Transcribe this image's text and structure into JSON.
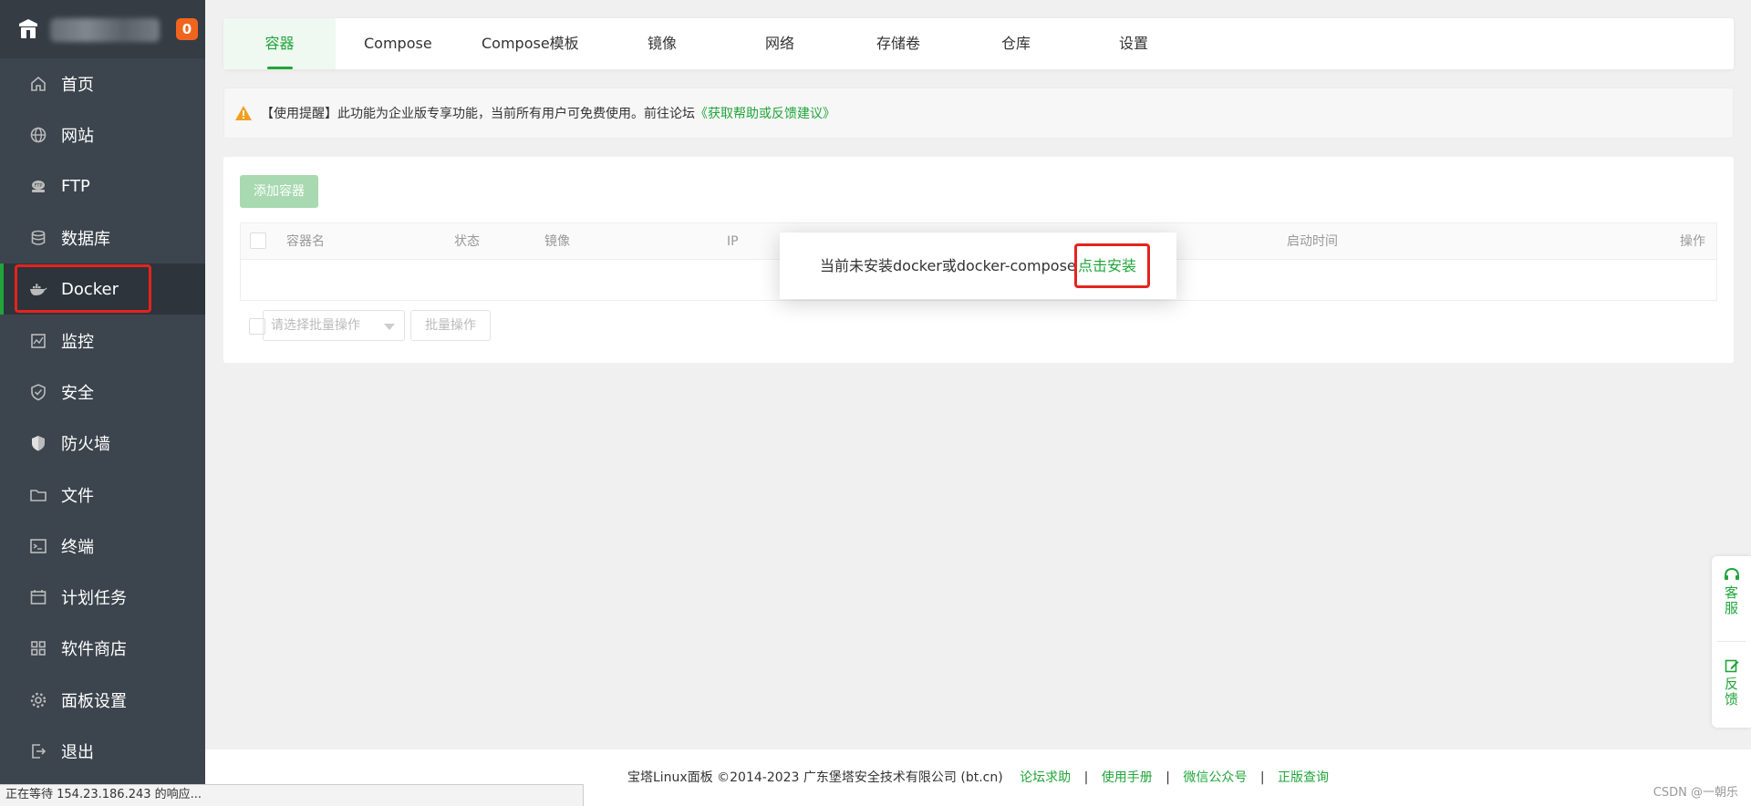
{
  "sidebar": {
    "badge": "0",
    "items": [
      {
        "label": "首页",
        "icon": "home-icon"
      },
      {
        "label": "网站",
        "icon": "globe-icon"
      },
      {
        "label": "FTP",
        "icon": "ftp-icon"
      },
      {
        "label": "数据库",
        "icon": "database-icon"
      },
      {
        "label": "Docker",
        "icon": "docker-icon",
        "active": true
      },
      {
        "label": "监控",
        "icon": "monitor-icon"
      },
      {
        "label": "安全",
        "icon": "shield-icon"
      },
      {
        "label": "防火墙",
        "icon": "firewall-icon"
      },
      {
        "label": "文件",
        "icon": "folder-icon"
      },
      {
        "label": "终端",
        "icon": "terminal-icon"
      },
      {
        "label": "计划任务",
        "icon": "calendar-icon"
      },
      {
        "label": "软件商店",
        "icon": "grid-icon"
      },
      {
        "label": "面板设置",
        "icon": "gear-icon"
      },
      {
        "label": "退出",
        "icon": "logout-icon"
      }
    ]
  },
  "tabs": [
    "容器",
    "Compose",
    "Compose模板",
    "镜像",
    "网络",
    "存储卷",
    "仓库",
    "设置"
  ],
  "notice": {
    "text": "【使用提醒】此功能为企业版专享功能，当前所有用户可免费使用。前往论坛",
    "link": "《获取帮助或反馈建议》"
  },
  "panel": {
    "add_button": "添加容器",
    "columns": [
      "容器名",
      "状态",
      "镜像",
      "IP",
      "启动时间",
      "操作"
    ],
    "batch_placeholder": "请选择批量操作",
    "batch_button": "批量操作"
  },
  "modal": {
    "message": "当前未安装docker或docker-compose",
    "install_link": "点击安装"
  },
  "footer": {
    "copyright": "宝塔Linux面板 ©2014-2023 广东堡塔安全技术有限公司 (bt.cn)",
    "links": [
      "论坛求助",
      "使用手册",
      "微信公众号",
      "正版查询"
    ]
  },
  "float": {
    "service": "客服",
    "feedback": "反馈"
  },
  "status_bar": "正在等待 154.23.186.243 的响应...",
  "watermark": "CSDN @一朝乐",
  "colors": {
    "accent": "#20a53a",
    "sidebar": "#3c444d",
    "highlight": "#e5231e"
  }
}
